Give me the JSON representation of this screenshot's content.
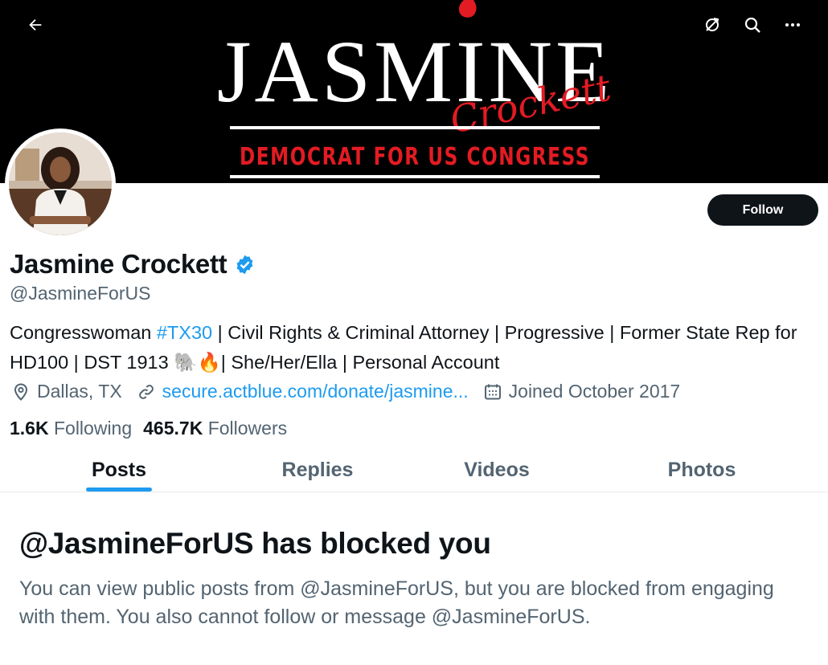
{
  "header": {
    "back_icon": "arrow-left-icon",
    "translate_icon": "translate-off-icon",
    "search_icon": "search-icon",
    "more_icon": "more-horizontal-icon"
  },
  "banner": {
    "logo_text": "JASMINE",
    "script_text": "Crockett",
    "tagline": "DEMOCRAT FOR US CONGRESS",
    "colors": {
      "background": "#000000",
      "accent": "#e31b23",
      "text": "#ffffff"
    }
  },
  "profile": {
    "display_name": "Jasmine Crockett",
    "verified": true,
    "handle": "@JasmineForUS",
    "follow_label": "Follow",
    "bio": {
      "part1": "Congresswoman ",
      "hashtag": "#TX30",
      "part2": " | Civil Rights & Criminal Attorney | Progressive | Former State Rep for HD100 | DST 1913 🐘🔥| She/Her/Ella | Personal Account"
    },
    "location": "Dallas, TX",
    "website": "secure.actblue.com/donate/jasmine...",
    "joined": "Joined October 2017",
    "following_count": "1.6K",
    "following_label": "Following",
    "followers_count": "465.7K",
    "followers_label": "Followers"
  },
  "tabs": [
    {
      "label": "Posts",
      "active": true
    },
    {
      "label": "Replies",
      "active": false
    },
    {
      "label": "Videos",
      "active": false
    },
    {
      "label": "Photos",
      "active": false
    }
  ],
  "blocked": {
    "title": "@JasmineForUS has blocked you",
    "message": "You can view public posts from @JasmineForUS, but you are blocked from engaging with them. You also cannot follow or message @JasmineForUS."
  },
  "colors": {
    "accent_blue": "#1d9bf0",
    "text_primary": "#0f1419",
    "text_secondary": "#536471"
  }
}
